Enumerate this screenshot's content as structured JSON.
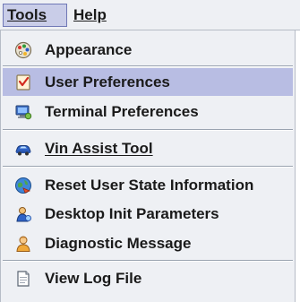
{
  "menubar": {
    "tools_label": "Tools",
    "help_label": "Help"
  },
  "menu": {
    "items": [
      {
        "label": "Appearance",
        "icon": "appearance-icon",
        "selected": false
      },
      {
        "label": "User Preferences",
        "icon": "user-preferences-icon",
        "selected": true
      },
      {
        "label": "Terminal Preferences",
        "icon": "terminal-preferences-icon",
        "selected": false
      },
      {
        "label": "Vin Assist Tool",
        "icon": "car-icon",
        "selected": false
      },
      {
        "label": "Reset User State Information",
        "icon": "reset-globe-icon",
        "selected": false
      },
      {
        "label": "Desktop Init Parameters",
        "icon": "desktop-init-icon",
        "selected": false
      },
      {
        "label": "Diagnostic Message",
        "icon": "user-person-icon",
        "selected": false
      },
      {
        "label": "View Log File",
        "icon": "document-icon",
        "selected": false
      }
    ]
  },
  "colors": {
    "menu_background": "#eef0f4",
    "selected_background": "#b8bde3",
    "menubar_active_border": "#6f78b6"
  }
}
